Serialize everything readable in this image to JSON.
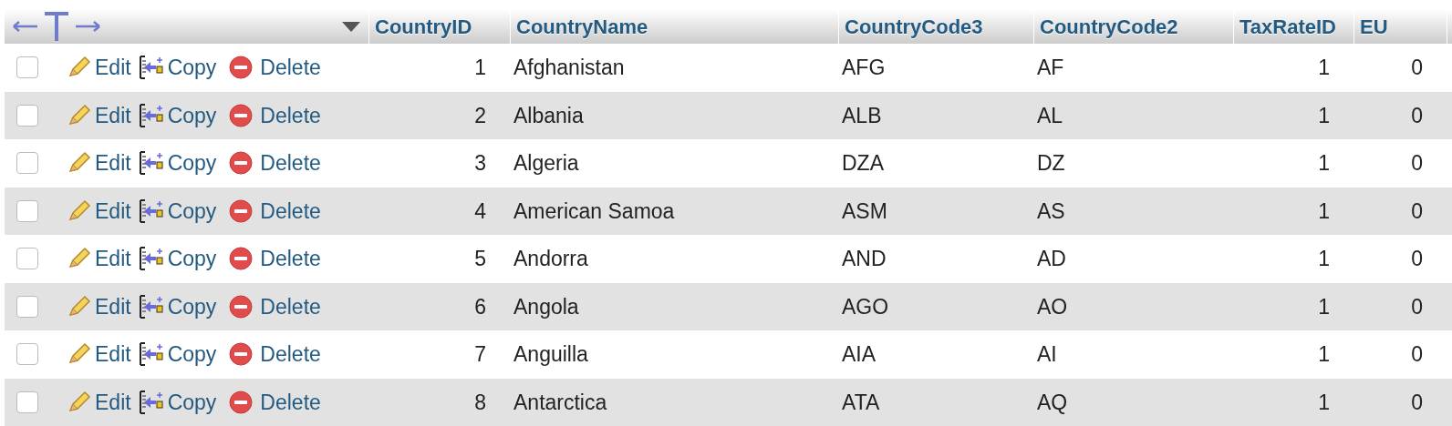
{
  "table": {
    "columns": [
      "CountryID",
      "CountryName",
      "CountryCode3",
      "CountryCode2",
      "TaxRateID",
      "EU"
    ],
    "rows": [
      {
        "checked": false,
        "actions": [
          "Edit",
          "Copy",
          "Delete"
        ],
        "cells": [
          "1",
          "Afghanistan",
          "AFG",
          "AF",
          "1",
          "0"
        ]
      },
      {
        "checked": false,
        "actions": [
          "Edit",
          "Copy",
          "Delete"
        ],
        "cells": [
          "2",
          "Albania",
          "ALB",
          "AL",
          "1",
          "0"
        ]
      },
      {
        "checked": false,
        "actions": [
          "Edit",
          "Copy",
          "Delete"
        ],
        "cells": [
          "3",
          "Algeria",
          "DZA",
          "DZ",
          "1",
          "0"
        ]
      },
      {
        "checked": false,
        "actions": [
          "Edit",
          "Copy",
          "Delete"
        ],
        "cells": [
          "4",
          "American Samoa",
          "ASM",
          "AS",
          "1",
          "0"
        ]
      },
      {
        "checked": false,
        "actions": [
          "Edit",
          "Copy",
          "Delete"
        ],
        "cells": [
          "5",
          "Andorra",
          "AND",
          "AD",
          "1",
          "0"
        ]
      },
      {
        "checked": false,
        "actions": [
          "Edit",
          "Copy",
          "Delete"
        ],
        "cells": [
          "6",
          "Angola",
          "AGO",
          "AO",
          "1",
          "0"
        ]
      },
      {
        "checked": false,
        "actions": [
          "Edit",
          "Copy",
          "Delete"
        ],
        "cells": [
          "7",
          "Anguilla",
          "AIA",
          "AI",
          "1",
          "0"
        ]
      },
      {
        "checked": false,
        "actions": [
          "Edit",
          "Copy",
          "Delete"
        ],
        "cells": [
          "8",
          "Antarctica",
          "ATA",
          "AQ",
          "1",
          "0"
        ]
      }
    ]
  }
}
